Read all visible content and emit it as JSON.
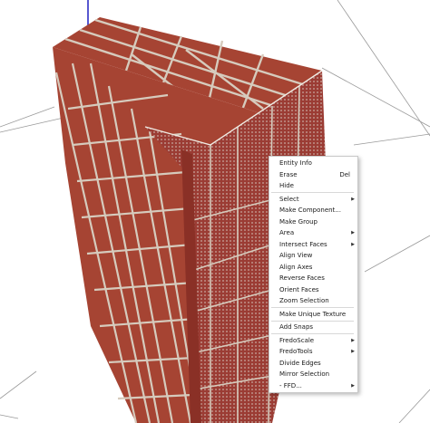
{
  "colors": {
    "brick": "#a64433",
    "brick_dark": "#7f2f23",
    "mortar": "#d6cbbd",
    "inner_face": "#9b3c34",
    "guide_line": "#9a9a9a",
    "axis_blue": "#2020c0",
    "menu_bg": "#ffffff",
    "menu_border": "#c8c8c8",
    "separator": "#d8d8d8"
  },
  "context_menu": {
    "items": [
      {
        "label": "Entity Info",
        "shortcut": "",
        "submenu": false,
        "sep_after": false
      },
      {
        "label": "Erase",
        "shortcut": "Del",
        "submenu": false,
        "sep_after": false
      },
      {
        "label": "Hide",
        "shortcut": "",
        "submenu": false,
        "sep_after": true
      },
      {
        "label": "Select",
        "shortcut": "",
        "submenu": true,
        "sep_after": false
      },
      {
        "label": "Make Component...",
        "shortcut": "",
        "submenu": false,
        "sep_after": false
      },
      {
        "label": "Make Group",
        "shortcut": "",
        "submenu": false,
        "sep_after": false
      },
      {
        "label": "Area",
        "shortcut": "",
        "submenu": true,
        "sep_after": false
      },
      {
        "label": "Intersect Faces",
        "shortcut": "",
        "submenu": true,
        "sep_after": false
      },
      {
        "label": "Align View",
        "shortcut": "",
        "submenu": false,
        "sep_after": false
      },
      {
        "label": "Align Axes",
        "shortcut": "",
        "submenu": false,
        "sep_after": false
      },
      {
        "label": "Reverse Faces",
        "shortcut": "",
        "submenu": false,
        "sep_after": false
      },
      {
        "label": "Orient Faces",
        "shortcut": "",
        "submenu": false,
        "sep_after": false
      },
      {
        "label": "Zoom Selection",
        "shortcut": "",
        "submenu": false,
        "sep_after": true
      },
      {
        "label": "Make Unique Texture",
        "shortcut": "",
        "submenu": false,
        "sep_after": true
      },
      {
        "label": "Add Snaps",
        "shortcut": "",
        "submenu": false,
        "sep_after": true
      },
      {
        "label": "FredoScale",
        "shortcut": "",
        "submenu": true,
        "sep_after": false
      },
      {
        "label": "FredoTools",
        "shortcut": "",
        "submenu": true,
        "sep_after": false
      },
      {
        "label": "Divide Edges",
        "shortcut": "",
        "submenu": false,
        "sep_after": false
      },
      {
        "label": "Mirror Selection",
        "shortcut": "",
        "submenu": false,
        "sep_after": false
      },
      {
        "label": "- FFD...",
        "shortcut": "",
        "submenu": true,
        "sep_after": false
      }
    ]
  }
}
